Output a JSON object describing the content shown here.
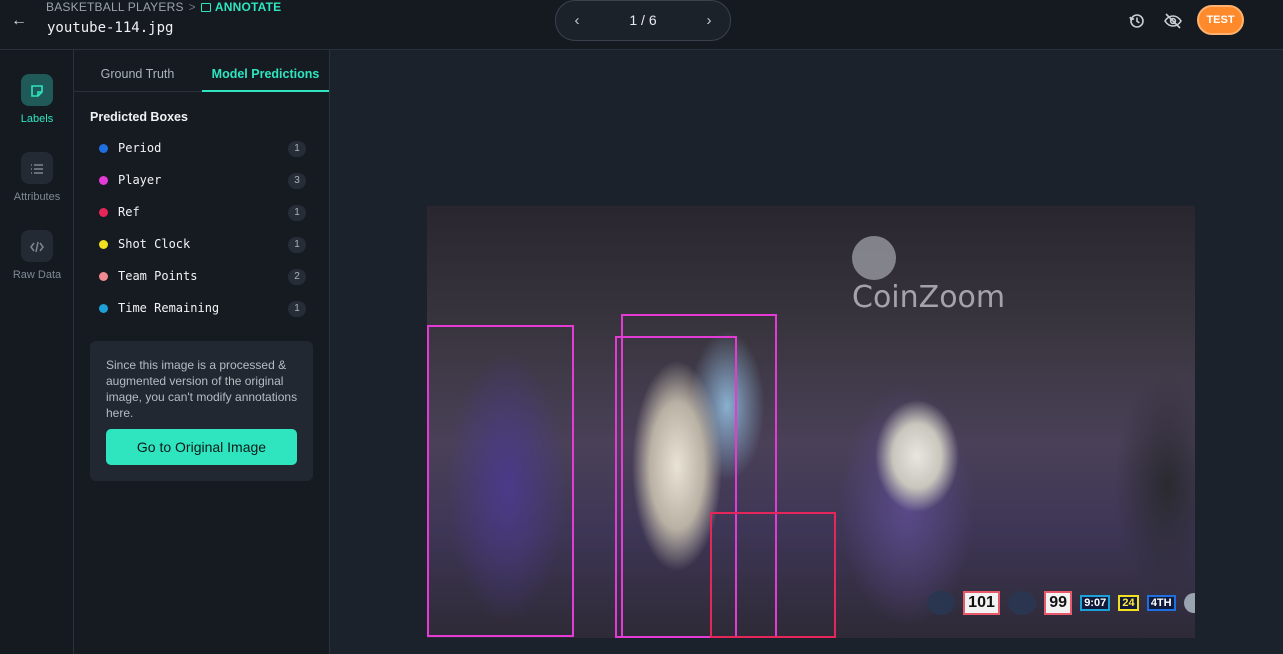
{
  "header": {
    "breadcrumb_project": "BASKETBALL PLAYERS",
    "breadcrumb_sep": ">",
    "breadcrumb_page": "ANNOTATE",
    "filename": "youtube-114.jpg",
    "pager": "1 / 6",
    "user_badge": "TEST"
  },
  "rail": {
    "labels": "Labels",
    "attributes": "Attributes",
    "raw_data": "Raw Data"
  },
  "tabs": {
    "ground_truth": "Ground Truth",
    "model_predictions": "Model Predictions"
  },
  "section_title": "Predicted Boxes",
  "classes": [
    {
      "name": "Period",
      "count": "1",
      "color": "#1e6fe0"
    },
    {
      "name": "Player",
      "count": "3",
      "color": "#e43ad6"
    },
    {
      "name": "Ref",
      "count": "1",
      "color": "#e6265a"
    },
    {
      "name": "Shot Clock",
      "count": "1",
      "color": "#f0e020"
    },
    {
      "name": "Team Points",
      "count": "2",
      "color": "#f08a90"
    },
    {
      "name": "Time Remaining",
      "count": "1",
      "color": "#1da0d8"
    }
  ],
  "notice": {
    "text": "Since this image is a processed & augmented version of the original image, you can't modify annotations here.",
    "button": "Go to Original Image"
  },
  "image": {
    "sign_text": "CoinZoom",
    "scorebug": {
      "home_points": "101",
      "away_points": "99",
      "time_remaining": "9:07",
      "shot_clock": "24",
      "period": "4TH"
    }
  }
}
